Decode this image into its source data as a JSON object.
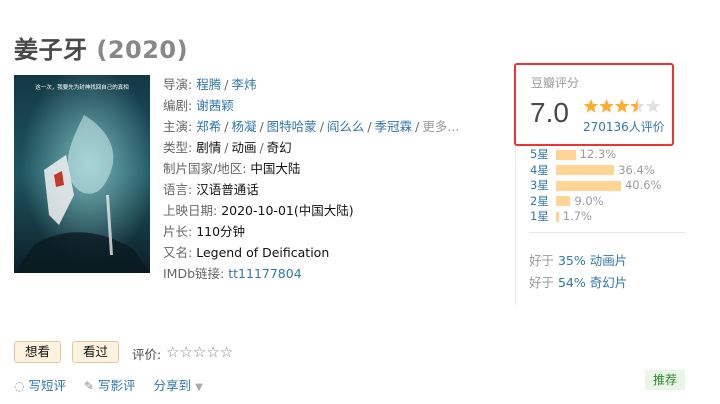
{
  "movie": {
    "title": "姜子牙",
    "year": "(2020)"
  },
  "poster": {
    "tagline": "这一次，我要先为封神找回自己的真相",
    "alt": "姜子牙 poster"
  },
  "info": {
    "director_label": "导演:",
    "directors": [
      "程腾",
      "李炜"
    ],
    "writer_label": "编剧:",
    "writer": "谢茜颖",
    "cast_label": "主演:",
    "cast": [
      "郑希",
      "杨凝",
      "图特哈蒙",
      "阎么么",
      "季冠霖"
    ],
    "cast_more": "更多...",
    "genre_label": "类型:",
    "genres": [
      "剧情",
      "动画",
      "奇幻"
    ],
    "country_label": "制片国家/地区:",
    "country": "中国大陆",
    "language_label": "语言:",
    "language": "汉语普通话",
    "release_label": "上映日期:",
    "release": "2020-10-01(中国大陆)",
    "runtime_label": "片长:",
    "runtime": "110分钟",
    "aka_label": "又名:",
    "aka": "Legend of Deification",
    "imdb_label": "IMDb链接:",
    "imdb": "tt11177804"
  },
  "rating": {
    "label": "豆瓣评分",
    "score": "7.0",
    "stars_value": 3.5,
    "count": "270136人评价",
    "distribution": [
      {
        "label": "5星",
        "pct": "12.3%",
        "value": 12.3
      },
      {
        "label": "4星",
        "pct": "36.4%",
        "value": 36.4
      },
      {
        "label": "3星",
        "pct": "40.6%",
        "value": 40.6
      },
      {
        "label": "2星",
        "pct": "9.0%",
        "value": 9.0
      },
      {
        "label": "1星",
        "pct": "1.7%",
        "value": 1.7
      }
    ],
    "better_than": [
      {
        "prefix": "好于 ",
        "value": "35% 动画片"
      },
      {
        "prefix": "好于 ",
        "value": "54% 奇幻片"
      }
    ]
  },
  "actions": {
    "want": "想看",
    "seen": "看过",
    "rate_label": "评价:",
    "rate_stars": "☆☆☆☆☆"
  },
  "links": {
    "short_review": "写短评",
    "review": "写影评",
    "share": "分享到"
  },
  "recommend": "推荐",
  "colors": {
    "link": "#3377aa",
    "star": "#ffac2d",
    "bar": "#ffd596",
    "highlight_border": "#ee3333"
  }
}
